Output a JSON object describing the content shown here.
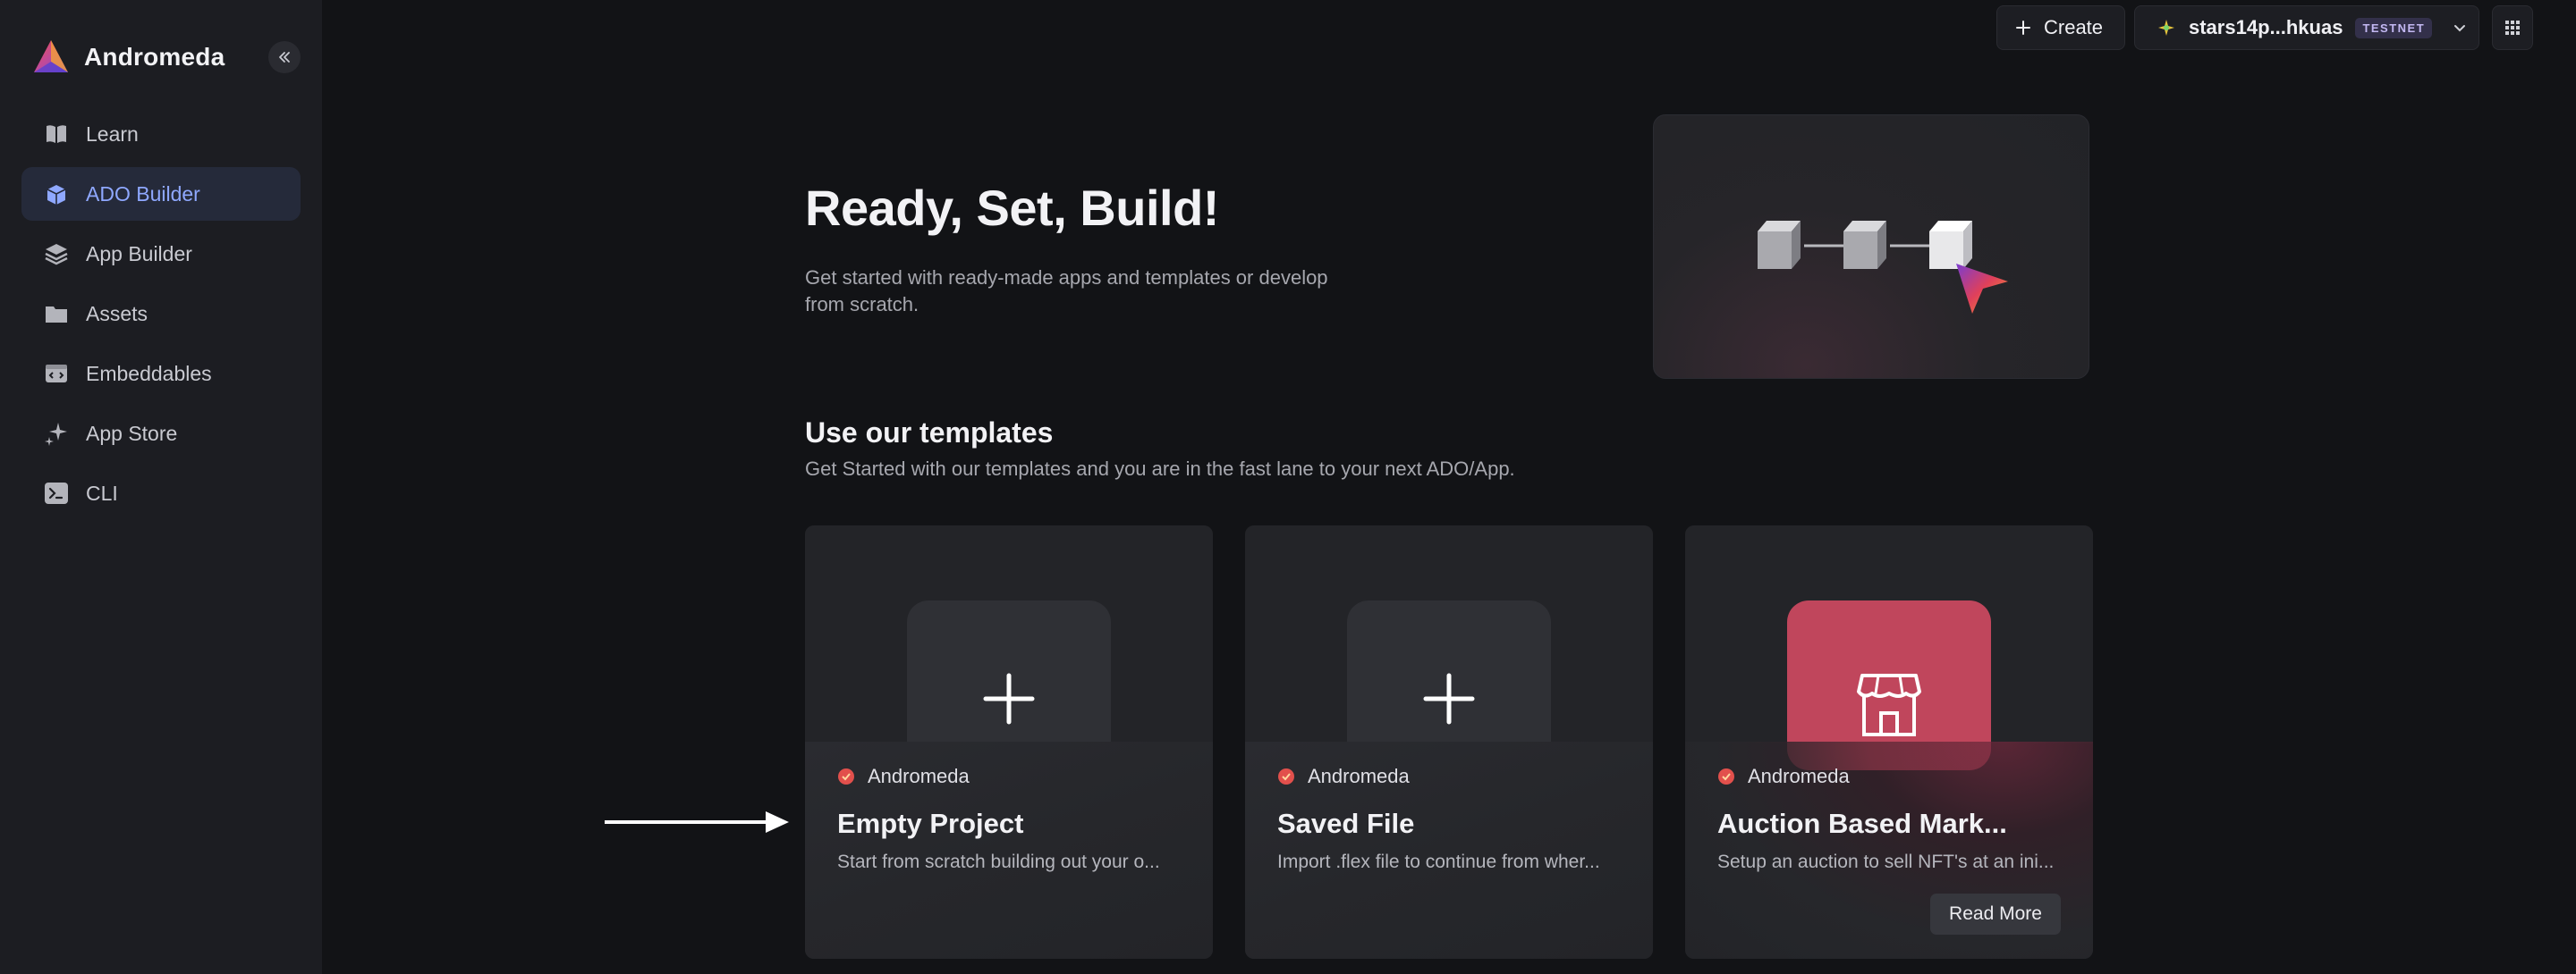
{
  "sidebar": {
    "brand": "Andromeda",
    "items": [
      {
        "label": "Learn",
        "icon": "book-icon"
      },
      {
        "label": "ADO Builder",
        "icon": "cube-icon",
        "active": true
      },
      {
        "label": "App Builder",
        "icon": "layers-icon"
      },
      {
        "label": "Assets",
        "icon": "folder-icon"
      },
      {
        "label": "Embeddables",
        "icon": "embed-icon"
      },
      {
        "label": "App Store",
        "icon": "sparkle-icon"
      },
      {
        "label": "CLI",
        "icon": "terminal-icon"
      }
    ]
  },
  "topbar": {
    "create_label": "Create",
    "wallet_address": "stars14p...hkuas",
    "network_badge": "TESTNET"
  },
  "hero": {
    "title": "Ready, Set, Build!",
    "description": "Get started with ready-made apps and templates or develop from scratch."
  },
  "templates": {
    "title": "Use our templates",
    "subtitle": "Get Started with our templates and you are in the fast lane to your next ADO/App.",
    "cards": [
      {
        "author": "Andromeda",
        "title": "Empty Project",
        "description": "Start from scratch building out your o...",
        "icon": "plus-icon"
      },
      {
        "author": "Andromeda",
        "title": "Saved File",
        "description": "Import .flex file to continue from wher...",
        "icon": "plus-icon"
      },
      {
        "author": "Andromeda",
        "title": "Auction Based Mark...",
        "description": "Setup an auction to sell NFT's at an ini...",
        "icon": "storefront-icon",
        "action": "Read More"
      }
    ]
  },
  "colors": {
    "accent": "#8fa8ff",
    "active_bg": "#252a3a",
    "auction_tile": "#c0465c",
    "background": "#121316",
    "sidebar": "#1c1d22"
  }
}
